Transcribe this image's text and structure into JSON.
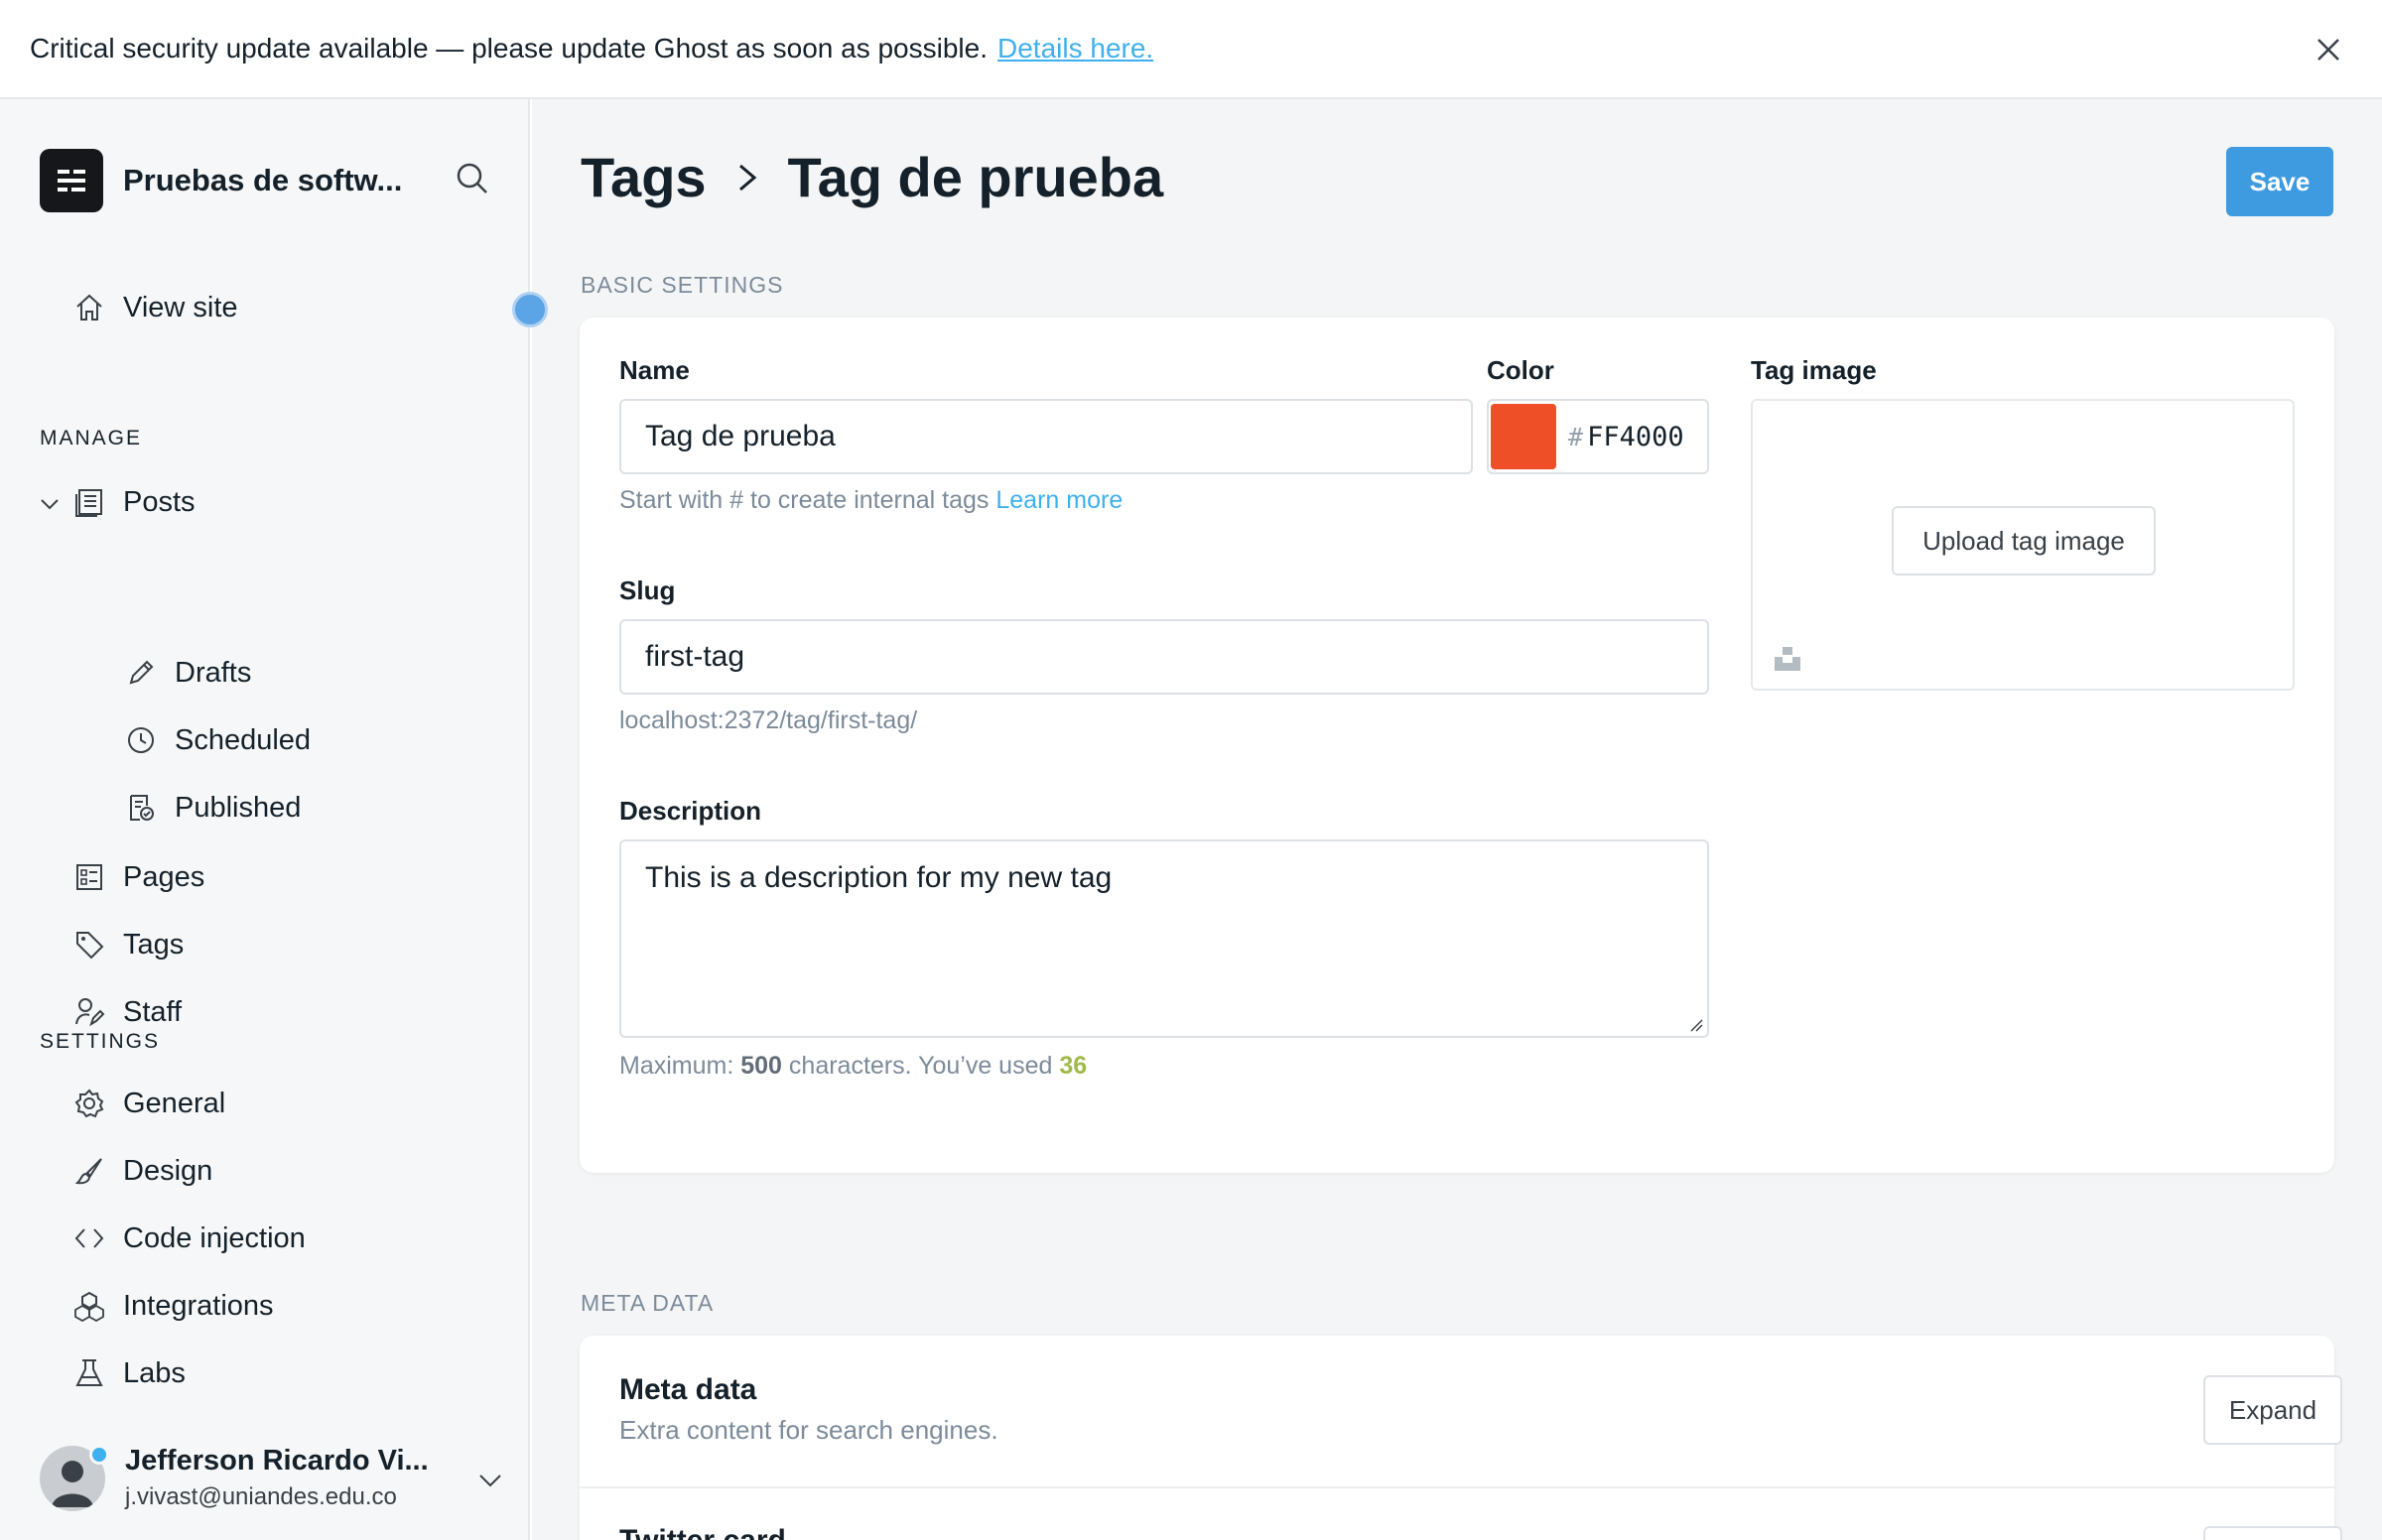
{
  "banner": {
    "text": "Critical security update available — please update Ghost as soon as possible.",
    "link": "Details here."
  },
  "sidebar": {
    "site_name": "Pruebas de softw...",
    "view_site": "View site",
    "manage_label": "MANAGE",
    "manage_items": [
      {
        "label": "Posts",
        "icon": "posts-icon"
      },
      {
        "label": "Drafts",
        "icon": "pencil-icon"
      },
      {
        "label": "Scheduled",
        "icon": "clock-icon"
      },
      {
        "label": "Published",
        "icon": "published-icon"
      },
      {
        "label": "Pages",
        "icon": "pages-icon"
      },
      {
        "label": "Tags",
        "icon": "tag-icon"
      },
      {
        "label": "Staff",
        "icon": "staff-icon"
      }
    ],
    "settings_label": "SETTINGS",
    "settings_items": [
      {
        "label": "General",
        "icon": "gear-icon"
      },
      {
        "label": "Design",
        "icon": "brush-icon"
      },
      {
        "label": "Code injection",
        "icon": "code-icon"
      },
      {
        "label": "Integrations",
        "icon": "integrations-icon"
      },
      {
        "label": "Labs",
        "icon": "flask-icon"
      }
    ],
    "user": {
      "name": "Jefferson Ricardo Vi...",
      "email": "j.vivast@uniandes.edu.co"
    }
  },
  "header": {
    "crumb_parent": "Tags",
    "crumb_current": "Tag de prueba",
    "save_label": "Save"
  },
  "basic": {
    "section_title": "BASIC SETTINGS",
    "name_label": "Name",
    "name_value": "Tag de prueba",
    "name_hint": "Start with # to create internal tags",
    "name_hint_link": "Learn more",
    "color_label": "Color",
    "color_hash": "#",
    "color_value": "FF4000",
    "color_hex": "#ef4f27",
    "image_label": "Tag image",
    "upload_label": "Upload tag image",
    "slug_label": "Slug",
    "slug_value": "first-tag",
    "slug_url": "localhost:2372/tag/first-tag/",
    "desc_label": "Description",
    "desc_value": "This is a description for my new tag",
    "desc_hint_prefix": "Maximum:",
    "desc_max": "500",
    "desc_hint_mid": "characters. You’ve used",
    "desc_used": "36"
  },
  "meta": {
    "section_title": "META DATA",
    "title": "Meta data",
    "subtitle": "Extra content for search engines.",
    "expand_label": "Expand",
    "next_title": "Twitter card"
  }
}
